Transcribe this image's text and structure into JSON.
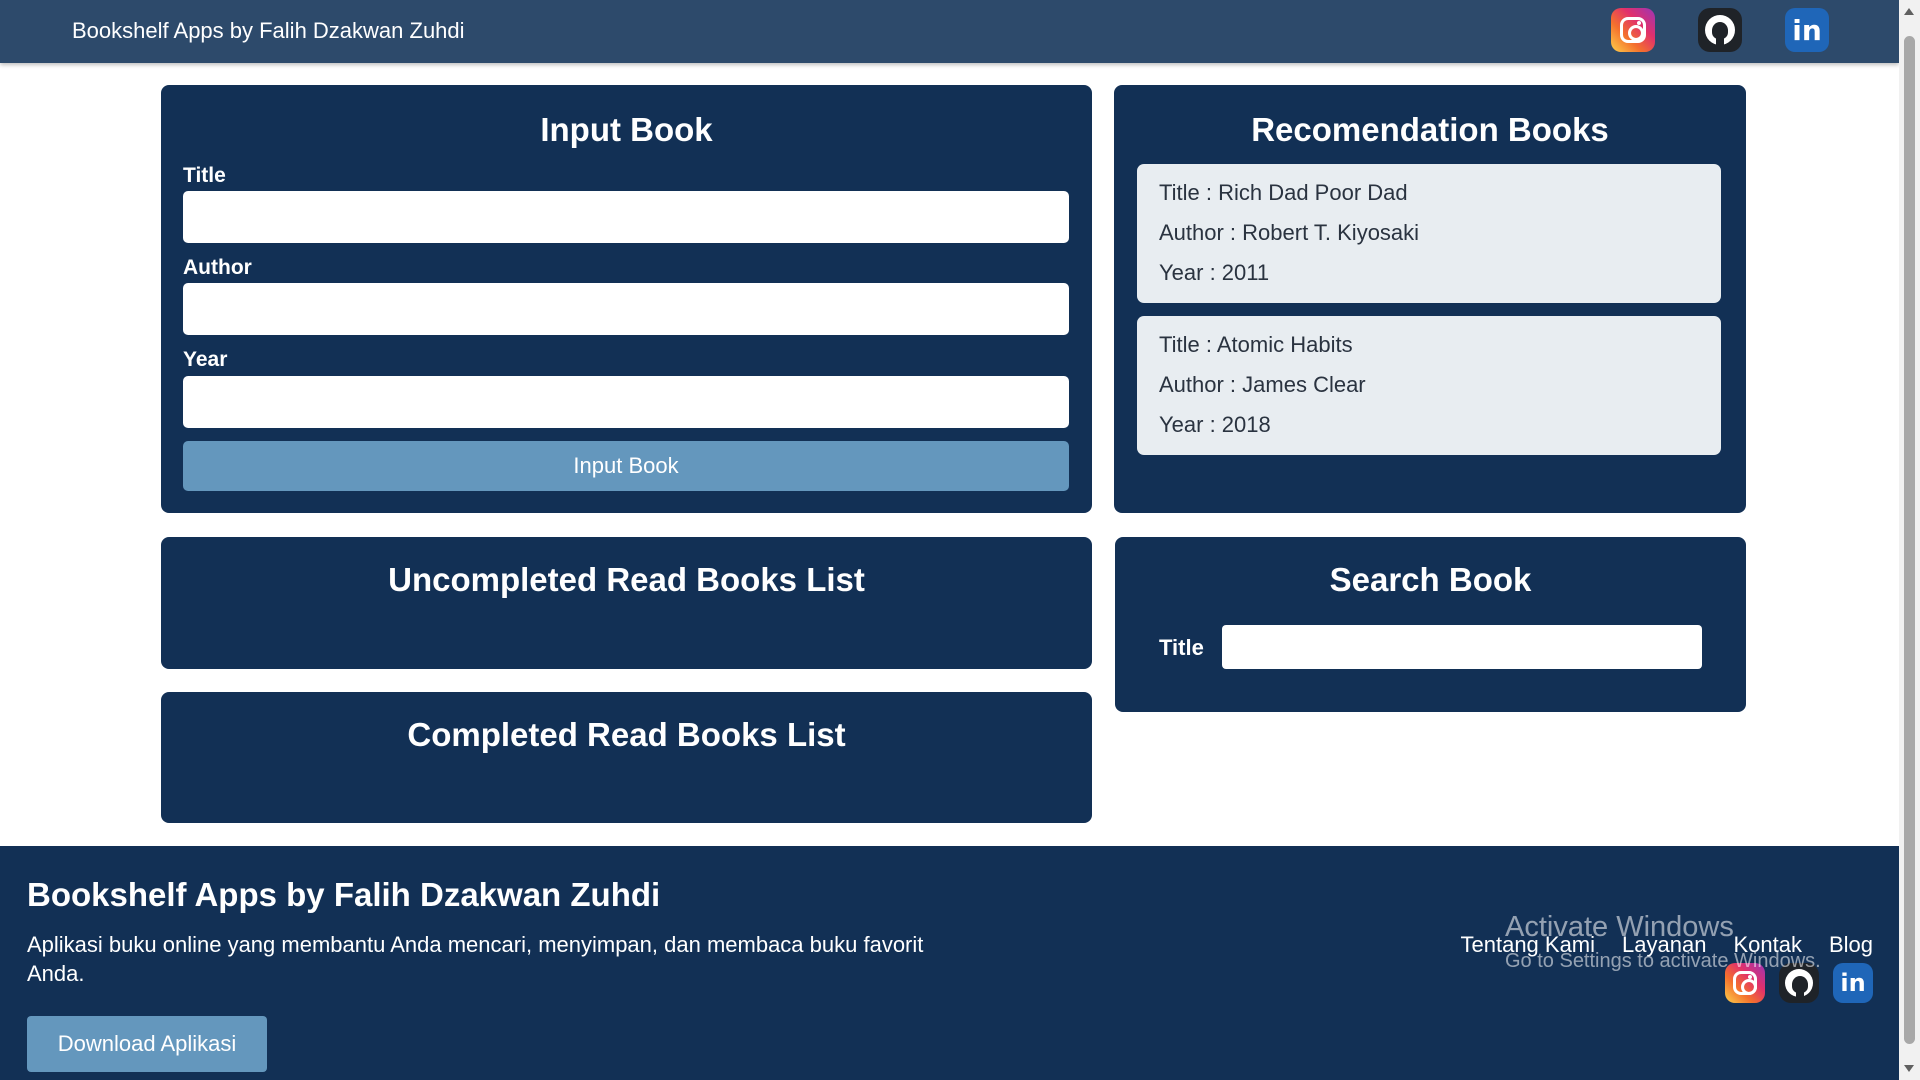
{
  "header": {
    "brand": "Bookshelf Apps by Falih Dzakwan Zuhdi",
    "social_icons": [
      "instagram-icon",
      "github-icon",
      "linkedin-icon"
    ],
    "linkedin_glyph": "in"
  },
  "input_panel": {
    "title": "Input Book",
    "title_label": "Title",
    "author_label": "Author",
    "year_label": "Year",
    "title_value": "",
    "author_value": "",
    "year_value": "",
    "submit_label": "Input Book"
  },
  "recommendations": {
    "title": "Recomendation Books",
    "books": [
      {
        "title": "Title : Rich Dad Poor Dad",
        "author": "Author : Robert T. Kiyosaki",
        "year": "Year : 2011"
      },
      {
        "title": "Title : Atomic Habits",
        "author": "Author : James Clear",
        "year": "Year : 2018"
      }
    ]
  },
  "uncompleted": {
    "title": "Uncompleted Read Books List"
  },
  "completed": {
    "title": "Completed Read Books List"
  },
  "search": {
    "title": "Search Book",
    "label": "Title",
    "value": ""
  },
  "footer": {
    "title": "Bookshelf Apps by Falih Dzakwan Zuhdi",
    "description": "Aplikasi buku online yang membantu Anda mencari, menyimpan, dan membaca buku favorit Anda.",
    "download_label": "Download Aplikasi",
    "links": [
      "Tentang Kami",
      "Layanan",
      "Kontak",
      "Blog"
    ],
    "linkedin_glyph": "in"
  },
  "watermark": {
    "line1": "Activate Windows",
    "line2": "Go to Settings to activate Windows."
  },
  "colors": {
    "header_bg": "#2d4a6b",
    "panel_bg": "#123055",
    "button_bg": "#6497bd",
    "card_bg": "#e8edf1"
  }
}
